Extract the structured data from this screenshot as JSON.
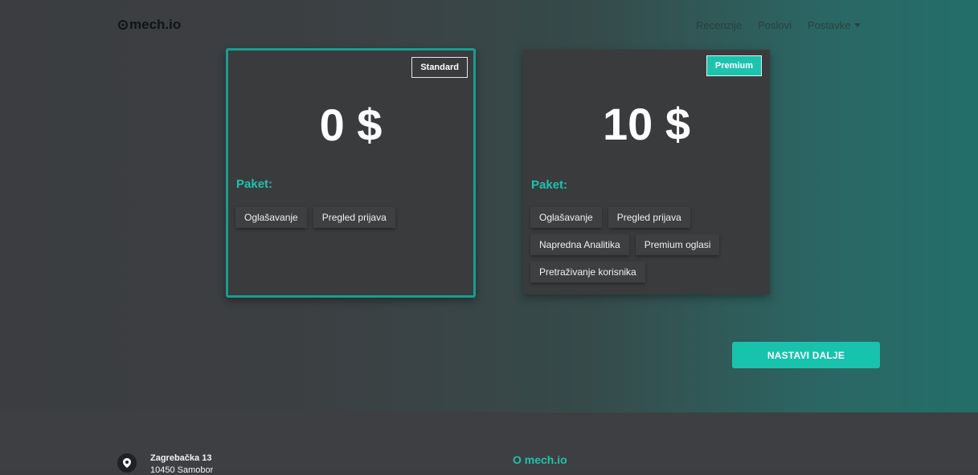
{
  "nav": {
    "logo": "mech.io",
    "links": [
      "Recenzije",
      "Poslovi",
      "Postavke"
    ]
  },
  "plans": {
    "standard": {
      "badge": "Standard",
      "price": "0 $",
      "package_label": "Paket:",
      "features": [
        "Oglašavanje",
        "Pregled prijava"
      ]
    },
    "premium": {
      "badge": "Premium",
      "price": "10 $",
      "package_label": "Paket:",
      "features": [
        "Oglašavanje",
        "Pregled prijava",
        "Napredna Analitika",
        "Premium oglasi",
        "Pretraživanje korisnika"
      ]
    }
  },
  "actions": {
    "next_label": "NASTAVI DALJE"
  },
  "footer": {
    "address_line1": "Zagrebačka 13",
    "address_line2": "10450 Samobor",
    "about_title": "O mech.io"
  },
  "colors": {
    "accent": "#1ec3ae",
    "card_bg": "#3a3b3d",
    "footer_bg": "#3e3f42"
  }
}
